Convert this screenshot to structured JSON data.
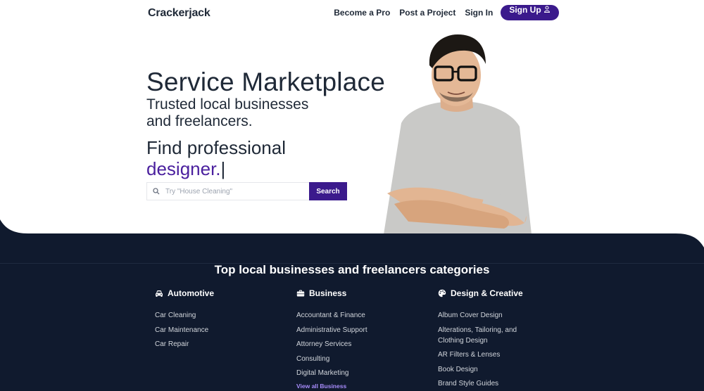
{
  "header": {
    "logo": "Crackerjack",
    "nav": {
      "become_pro": "Become a Pro",
      "post_project": "Post a Project",
      "sign_in": "Sign In",
      "sign_up": "Sign Up"
    }
  },
  "hero": {
    "title": "Service Marketplace",
    "subtitle": "Trusted local businesses and freelancers.",
    "find_prefix": "Find professional",
    "find_role": "designer.",
    "cursor": "|",
    "search": {
      "placeholder": "Try \"House Cleaning\"",
      "button": "Search"
    }
  },
  "categories": {
    "heading": "Top local businesses and freelancers categories",
    "columns": [
      {
        "title": "Automotive",
        "icon": "car-icon",
        "items": [
          "Car Cleaning",
          "Car Maintenance",
          "Car Repair"
        ]
      },
      {
        "title": "Business",
        "icon": "briefcase-icon",
        "items": [
          "Accountant & Finance",
          "Administrative Support",
          "Attorney Services",
          "Consulting",
          "Digital Marketing"
        ],
        "view_all": "View all Business"
      },
      {
        "title": "Design & Creative",
        "icon": "palette-icon",
        "items": [
          "Album Cover Design",
          "Alterations, Tailoring, and Clothing Design",
          "AR Filters & Lenses",
          "Book Design",
          "Brand Style Guides"
        ]
      }
    ]
  },
  "colors": {
    "brand_purple": "#3b1a8c",
    "accent_purple": "#4a1f9e",
    "dark_navy": "#101a2e"
  }
}
